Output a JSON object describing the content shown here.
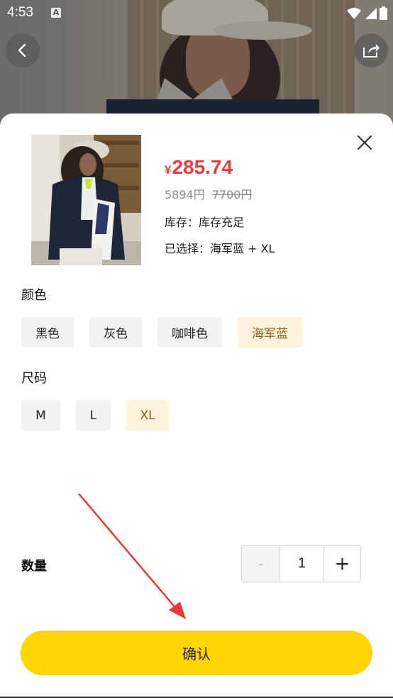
{
  "status_bar": {
    "time": "4:53",
    "notification_icon": "a-icon",
    "icons": [
      "wifi-icon",
      "signal-icon",
      "battery-icon"
    ]
  },
  "nav": {
    "back_icon": "chevron-left-icon",
    "share_icon": "share-icon"
  },
  "product": {
    "currency": "¥",
    "price": "285.74",
    "member_price": "5894円",
    "original_price": "7700円",
    "stock": "库存：库存充足",
    "selected": "已选择：海军蓝 + XL"
  },
  "color_section": {
    "title": "颜色",
    "options": [
      "黑色",
      "灰色",
      "咖啡色",
      "海军蓝"
    ],
    "selected": "海军蓝"
  },
  "size_section": {
    "title": "尺码",
    "options": [
      "M",
      "L",
      "XL"
    ],
    "selected": "XL"
  },
  "quantity": {
    "label": "数量",
    "minus": "-",
    "value": "1",
    "plus": "+"
  },
  "confirm_label": "确认",
  "colors": {
    "price_red": "#ef3b3b",
    "confirm_yellow": "#ffd500",
    "selected_bg": "#fff3dc",
    "selected_text": "#8a5a18",
    "annotation_arrow": "#e53935"
  }
}
